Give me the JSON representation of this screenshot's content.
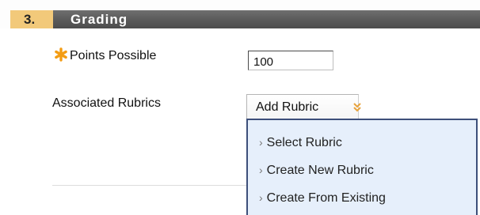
{
  "section": {
    "number": "3.",
    "title": "Grading"
  },
  "points": {
    "label": "Points Possible",
    "value": "100",
    "required": true
  },
  "rubrics": {
    "label": "Associated Rubrics",
    "button_label": "Add Rubric",
    "menu": [
      {
        "label": "Select Rubric"
      },
      {
        "label": "Create New Rubric"
      },
      {
        "label": "Create From Existing"
      }
    ]
  },
  "colors": {
    "accent": "#f2c97a",
    "header_bar": "#5b5b5b",
    "required_star": "#f39c12",
    "chevron": "#e8a33c",
    "menu_bg": "#e6effb",
    "menu_border": "#3d4f7a"
  },
  "icons": {
    "required": "asterisk-star-icon",
    "add_rubric_toggle": "double-chevron-down-icon",
    "menu_item": "chevron-right-icon"
  }
}
